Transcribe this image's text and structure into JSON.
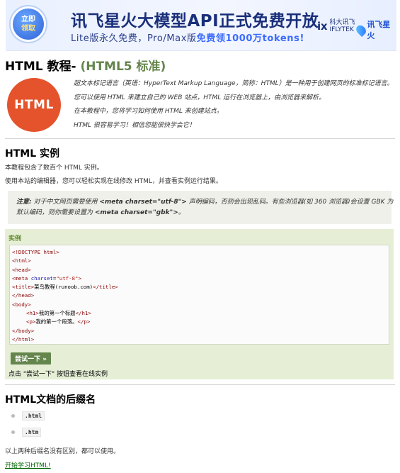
{
  "banner": {
    "badge_line1": "立即",
    "badge_line2": "领取",
    "headline": "讯飞星火大模型API正式免费开放",
    "sub_prefix": "Lite版永久免费，Pro/Max版",
    "sub_highlight": "免费领1000万tokens!",
    "logo1_top": "科大讯飞",
    "logo1_bottom": "IFLYTEK",
    "logo2": "讯飞星火"
  },
  "page": {
    "title_main": "HTML 教程- ",
    "title_sub": "(HTML5 标准)",
    "logo_text": "HTML",
    "intro": [
      "超文本标记语言（英语：HyperText Markup Language，简称：HTML）是一种用于创建网页的标准标记语言。",
      "您可以使用 HTML 来建立自己的 WEB 站点，HTML 运行在浏览器上，由浏览器来解析。",
      "在本教程中，您将学习如何使用 HTML 来创建站点。",
      "HTML 很容易学习！相信您能很快学会它！"
    ]
  },
  "section_example": {
    "heading": "HTML 实例",
    "line1": "本教程包含了数百个 HTML 实例。",
    "line2": "使用本站的编辑器，您可以轻松实现在线修改 HTML，并查看实例运行结果。",
    "note_label": "注意:",
    "note_text1": " 对于中文网页需要使用 ",
    "note_meta_utf8": "<meta charset=\"utf-8\">",
    "note_text2": " 声明编码，否则会出现乱码。有些浏览器(如 360 浏览器)会设置 GBK 为",
    "note_text3": "默认编码，则你需要设置为 ",
    "note_meta_gbk": "<meta charset=\"gbk\">",
    "note_text4": "。",
    "example_label": "实例",
    "code": {
      "l1": "<!DOCTYPE html>",
      "l2": "<html>",
      "l3": "<head>",
      "l4_tag": "<meta ",
      "l4_attr": "charset",
      "l4_eq": "=",
      "l4_val": "\"utf-8\"",
      "l4_end": ">",
      "l5_open": "<title>",
      "l5_text": "菜鸟教程(runoob.com)",
      "l5_close": "</title>",
      "l6": "</head>",
      "l7": "<body>",
      "l8_open": "<h1>",
      "l8_text": "我的第一个标题",
      "l8_close": "</h1>",
      "l9_open": "<p>",
      "l9_text": "我的第一个段落。",
      "l9_close": "</p>",
      "l10": "</body>",
      "l11": "</html>"
    },
    "try_button": "尝试一下 »",
    "hint": "点击 \"尝试一下\" 按钮查看在线实例"
  },
  "section_suffix": {
    "heading": "HTML文档的后缀名",
    "items": [
      ".html",
      ".htm"
    ],
    "note": "以上两种后缀名没有区别，都可以使用。",
    "link": "开始学习HTML!"
  }
}
